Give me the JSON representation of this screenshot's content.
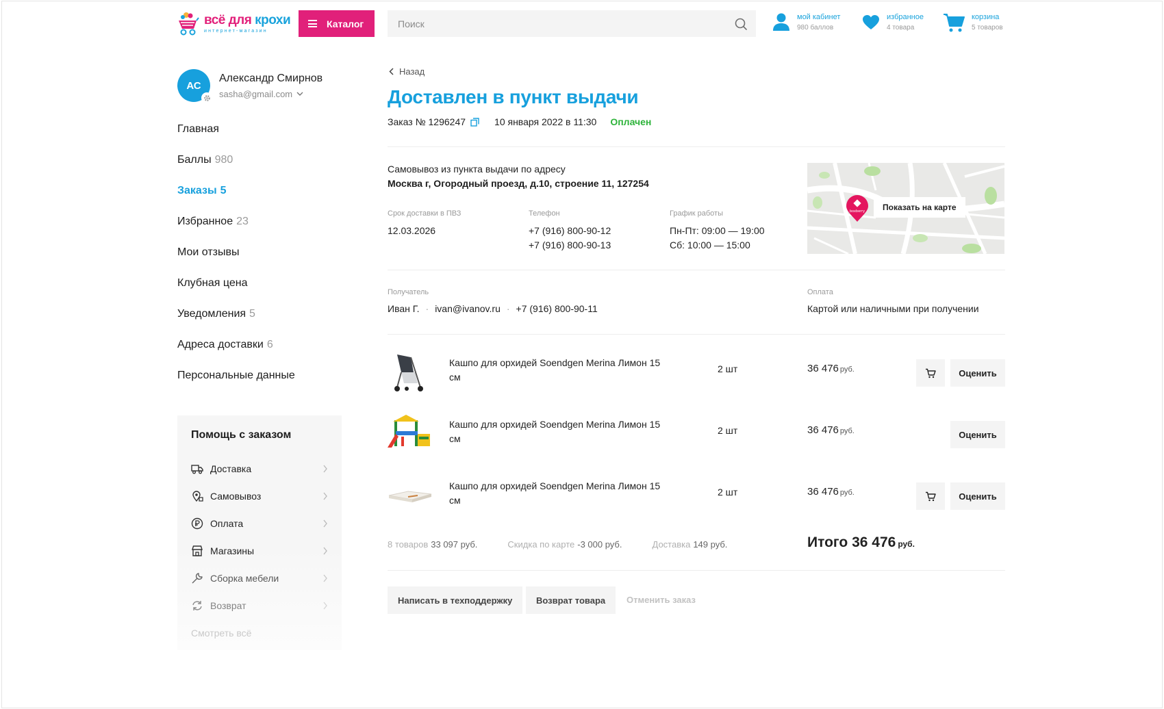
{
  "header": {
    "logo_title_a": "всё для",
    "logo_title_b": "крохи",
    "logo_subtitle": "интернет-магазин",
    "catalog_label": "Каталог",
    "search_placeholder": "Поиск",
    "account_label": "мой кабинет",
    "account_sub": "980 баллов",
    "favorites_label": "избранное",
    "favorites_sub": "4 товара",
    "cart_label": "корзина",
    "cart_sub": "5 товаров"
  },
  "user": {
    "initials": "АС",
    "name": "Александр Смирнов",
    "email": "sasha@gmail.com"
  },
  "nav": [
    {
      "label": "Главная",
      "count": ""
    },
    {
      "label": "Баллы",
      "count": "980"
    },
    {
      "label": "Заказы",
      "count": "5"
    },
    {
      "label": "Избранное",
      "count": "23"
    },
    {
      "label": "Мои отзывы",
      "count": ""
    },
    {
      "label": "Клубная цена",
      "count": ""
    },
    {
      "label": "Уведомления",
      "count": "5"
    },
    {
      "label": "Адреса доставки",
      "count": "6"
    },
    {
      "label": "Персональные данные",
      "count": ""
    }
  ],
  "help": {
    "title": "Помощь с заказом",
    "items": [
      "Доставка",
      "Самовывоз",
      "Оплата",
      "Магазины",
      "Сборка мебели",
      "Возврат"
    ],
    "more": "Смотреть всё"
  },
  "order": {
    "back": "Назад",
    "status": "Доставлен в пункт выдачи",
    "number": "Заказ № 1296247",
    "date": "10 января 2022 в 11:30",
    "payment_status": "Оплачен"
  },
  "pickup": {
    "label": "Самовывоз из пункта выдачи по адресу",
    "address": "Москва г, Огородный проезд, д.10, строение 11, 127254",
    "term_cap": "Срок доставки в ПВЗ",
    "term_val": "12.03.2026",
    "phone_cap": "Телефон",
    "phone_1": "+7 (916) 800-90-12",
    "phone_2": "+7 (916) 800-90-13",
    "hours_cap": "График работы",
    "hours_1": "Пн-Пт: 09:00 — 19:00",
    "hours_2": "Сб: 10:00 — 15:00",
    "map_button": "Показать на карте",
    "map_brand": "boxberry"
  },
  "recipient": {
    "cap": "Получатель",
    "name": "Иван Г.",
    "email": "ivan@ivanov.ru",
    "phone": "+7 (916) 800-90-11",
    "pay_cap": "Оплата",
    "pay_val": "Картой или наличными при получении"
  },
  "items": [
    {
      "name": "Кашпо для орхидей Soendgen Merina Лимон 15 см",
      "qty": "2 шт",
      "price": "36 476",
      "currency": "руб.",
      "rate": "Оценить",
      "has_cart": true
    },
    {
      "name": "Кашпо для орхидей Soendgen Merina Лимон 15 см",
      "qty": "2 шт",
      "price": "36 476",
      "currency": "руб.",
      "rate": "Оценить",
      "has_cart": false
    },
    {
      "name": "Кашпо для орхидей Soendgen Merina Лимон 15 см",
      "qty": "2 шт",
      "price": "36 476",
      "currency": "руб.",
      "rate": "Оценить",
      "has_cart": true
    }
  ],
  "totals": {
    "goods_label": "8 товаров",
    "goods_val": "33 097 руб.",
    "discount_label": "Скидка по карте",
    "discount_val": "-3 000 руб.",
    "delivery_label": "Доставка",
    "delivery_val": "149 руб.",
    "grand_label": "Итого",
    "grand_val": "36 476",
    "grand_currency": "руб."
  },
  "actions": {
    "support": "Написать в техподдержку",
    "return": "Возврат товара",
    "cancel": "Отменить заказ"
  },
  "colors": {
    "brand_pink": "#e1207a",
    "brand_blue": "#17a0dd",
    "paid_green": "#2db33a"
  }
}
